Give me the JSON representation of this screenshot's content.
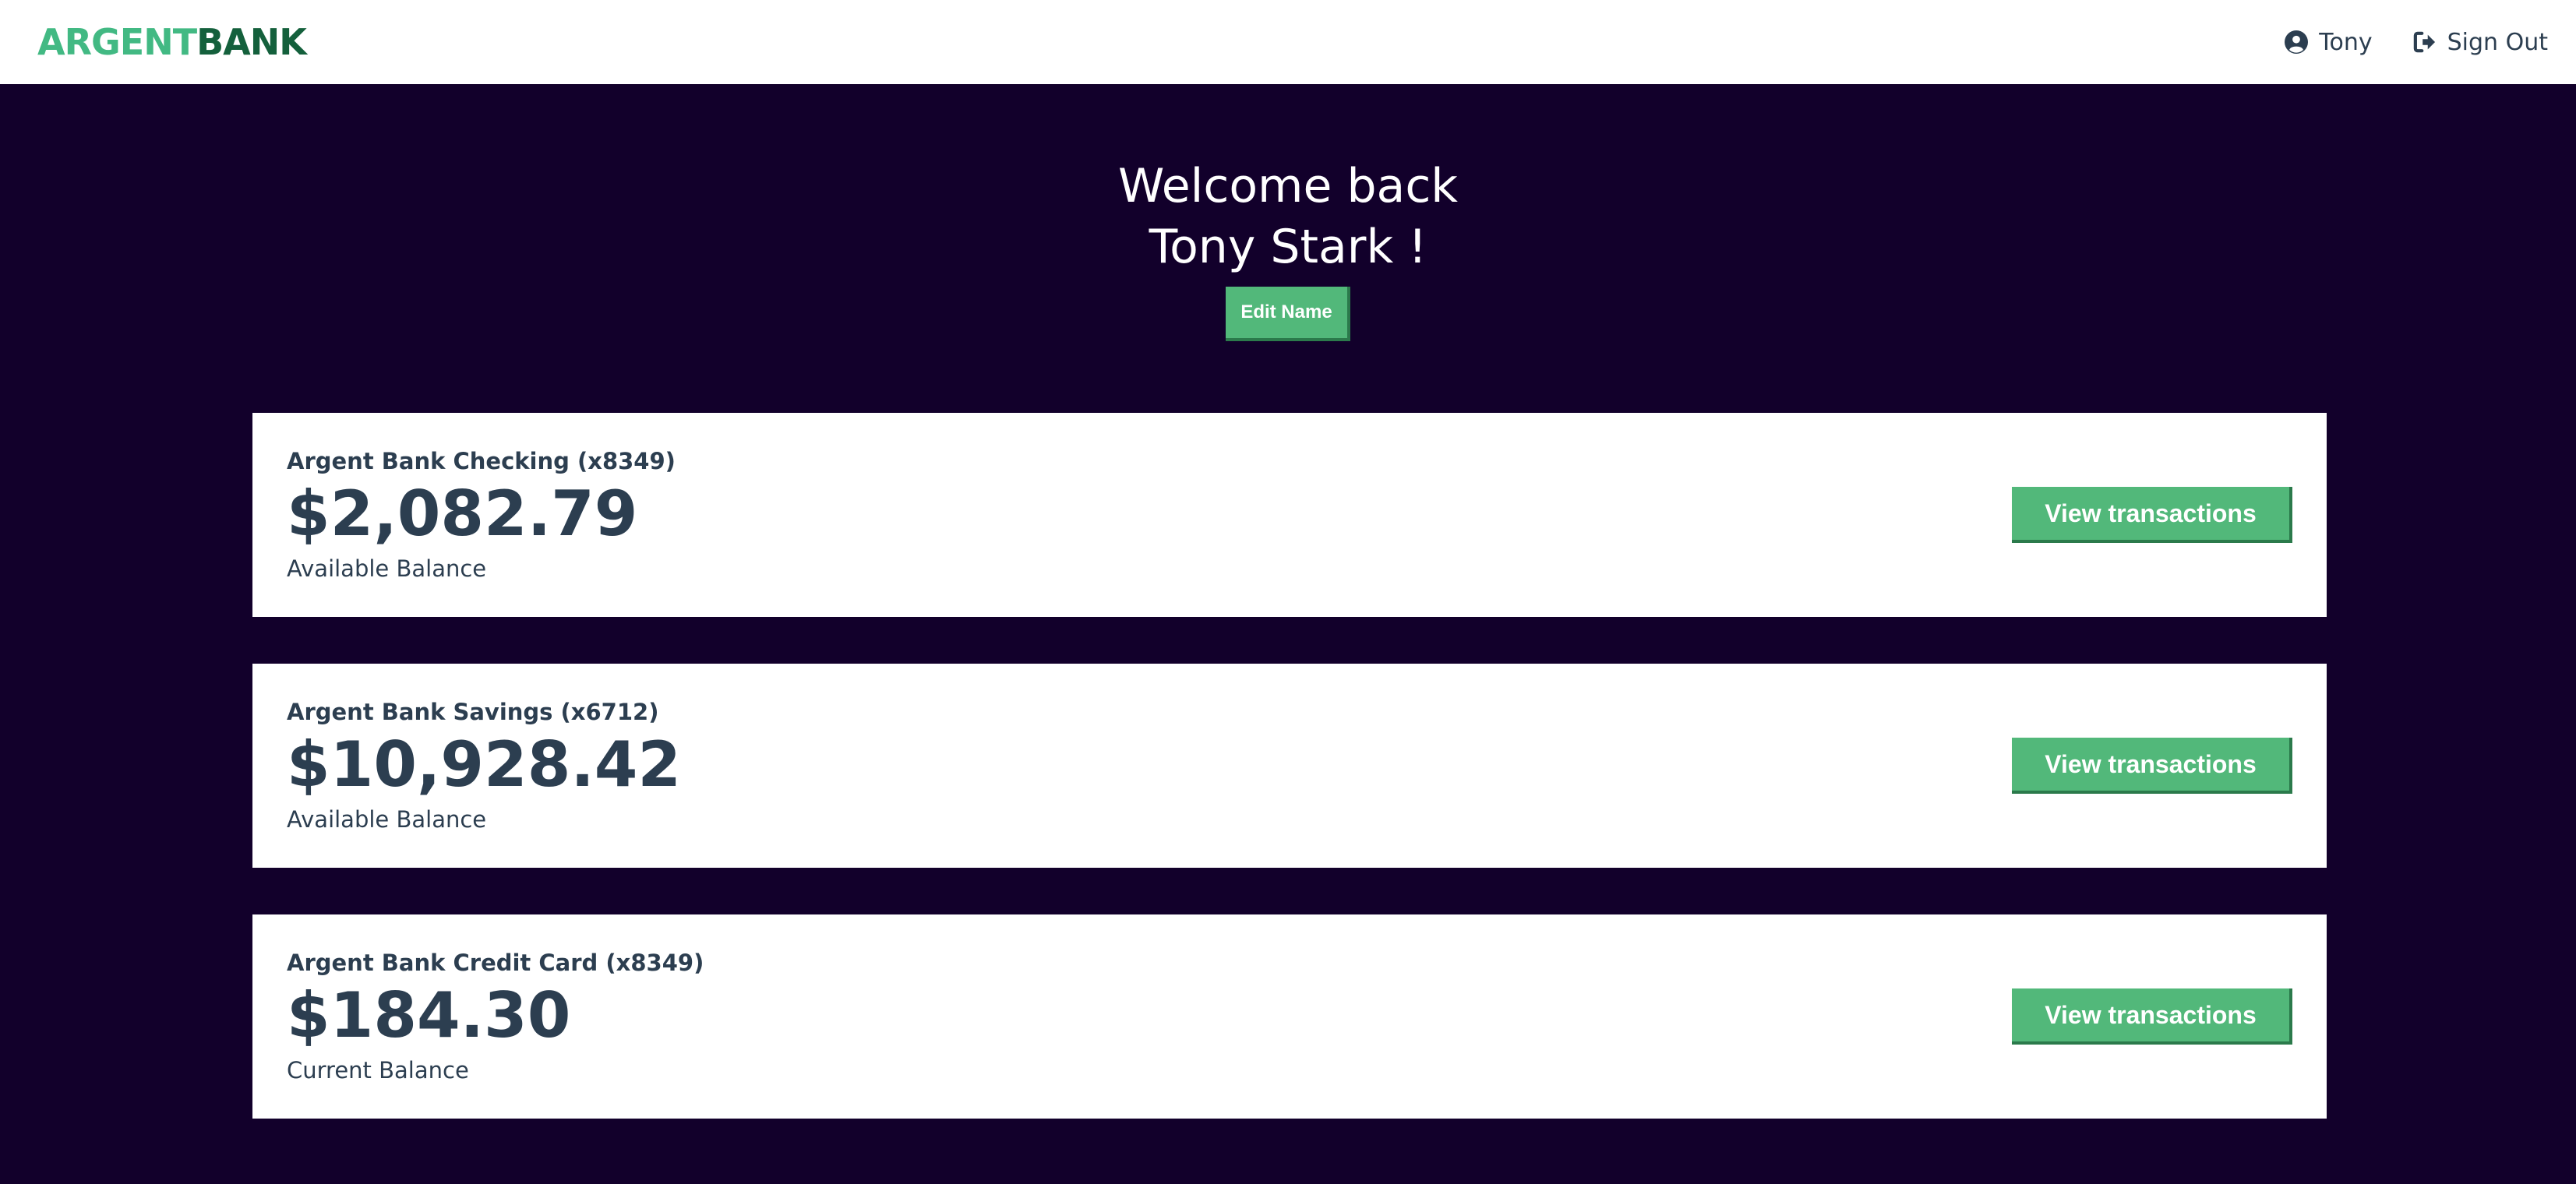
{
  "nav": {
    "logo_part1": "ARGENT",
    "logo_part2": "BANK",
    "user_name": "Tony",
    "sign_out_label": "Sign Out"
  },
  "header": {
    "welcome_line1": "Welcome back",
    "welcome_line2": "Tony Stark !",
    "edit_button_label": "Edit Name"
  },
  "accounts": [
    {
      "title": "Argent Bank Checking (x8349)",
      "amount": "$2,082.79",
      "amount_description": "Available Balance",
      "button_label": "View transactions"
    },
    {
      "title": "Argent Bank Savings (x6712)",
      "amount": "$10,928.42",
      "amount_description": "Available Balance",
      "button_label": "View transactions"
    },
    {
      "title": "Argent Bank Credit Card (x8349)",
      "amount": "$184.30",
      "amount_description": "Current Balance",
      "button_label": "View transactions"
    }
  ],
  "icons": {
    "user": "user-circle-icon",
    "sign_out": "sign-out-icon"
  },
  "colors": {
    "background": "#12002b",
    "accent": "#42b983",
    "logo_dark": "#14603c",
    "button": "#52b87a",
    "text": "#2c3e50"
  }
}
